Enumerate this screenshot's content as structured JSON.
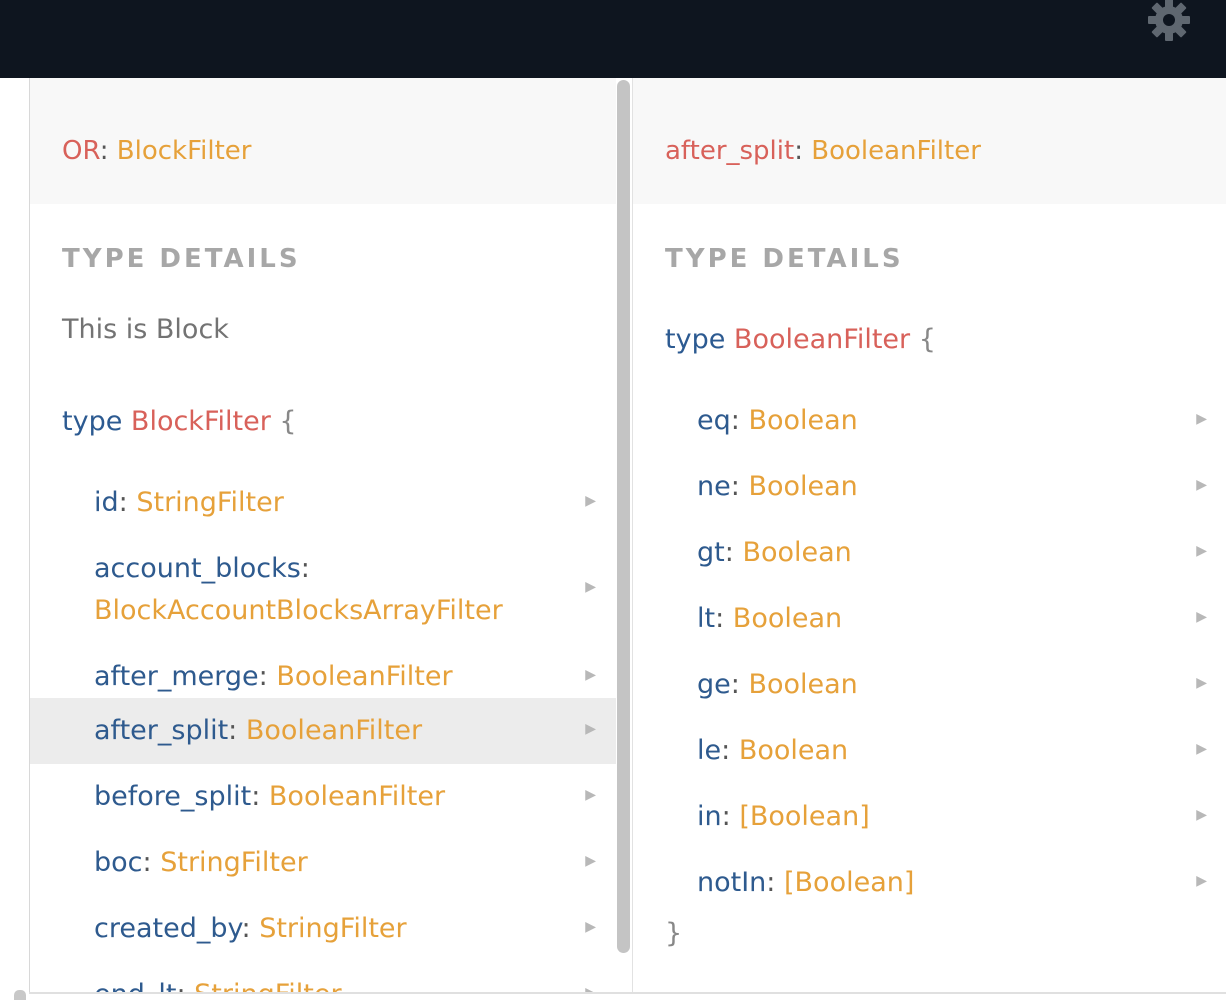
{
  "topbar": {
    "settings_icon": "gear-icon"
  },
  "panel1": {
    "title_field": "OR",
    "title_type": "BlockFilter",
    "section_label": "TYPE DETAILS",
    "description": "This is Block",
    "decl_keyword": "type",
    "decl_name": "BlockFilter",
    "decl_brace": "{",
    "fields": [
      {
        "name": "id",
        "type": "StringFilter"
      },
      {
        "name": "account_blocks",
        "type": "BlockAccountBlocksArrayFilter"
      },
      {
        "name": "after_merge",
        "type": "BooleanFilter"
      },
      {
        "name": "after_split",
        "type": "BooleanFilter"
      },
      {
        "name": "before_split",
        "type": "BooleanFilter"
      },
      {
        "name": "boc",
        "type": "StringFilter"
      },
      {
        "name": "created_by",
        "type": "StringFilter"
      },
      {
        "name": "end_lt",
        "type": "StringFilter"
      }
    ]
  },
  "panel2": {
    "title_field": "after_split",
    "title_type": "BooleanFilter",
    "section_label": "TYPE DETAILS",
    "decl_keyword": "type",
    "decl_name": "BooleanFilter",
    "decl_brace": "{",
    "closing_brace": "}",
    "fields": [
      {
        "name": "eq",
        "type": "Boolean"
      },
      {
        "name": "ne",
        "type": "Boolean"
      },
      {
        "name": "gt",
        "type": "Boolean"
      },
      {
        "name": "lt",
        "type": "Boolean"
      },
      {
        "name": "ge",
        "type": "Boolean"
      },
      {
        "name": "le",
        "type": "Boolean"
      },
      {
        "name": "in",
        "type": "[Boolean]"
      },
      {
        "name": "notIn",
        "type": "[Boolean]"
      }
    ]
  },
  "colon": ":",
  "arrow_glyph": "▶"
}
